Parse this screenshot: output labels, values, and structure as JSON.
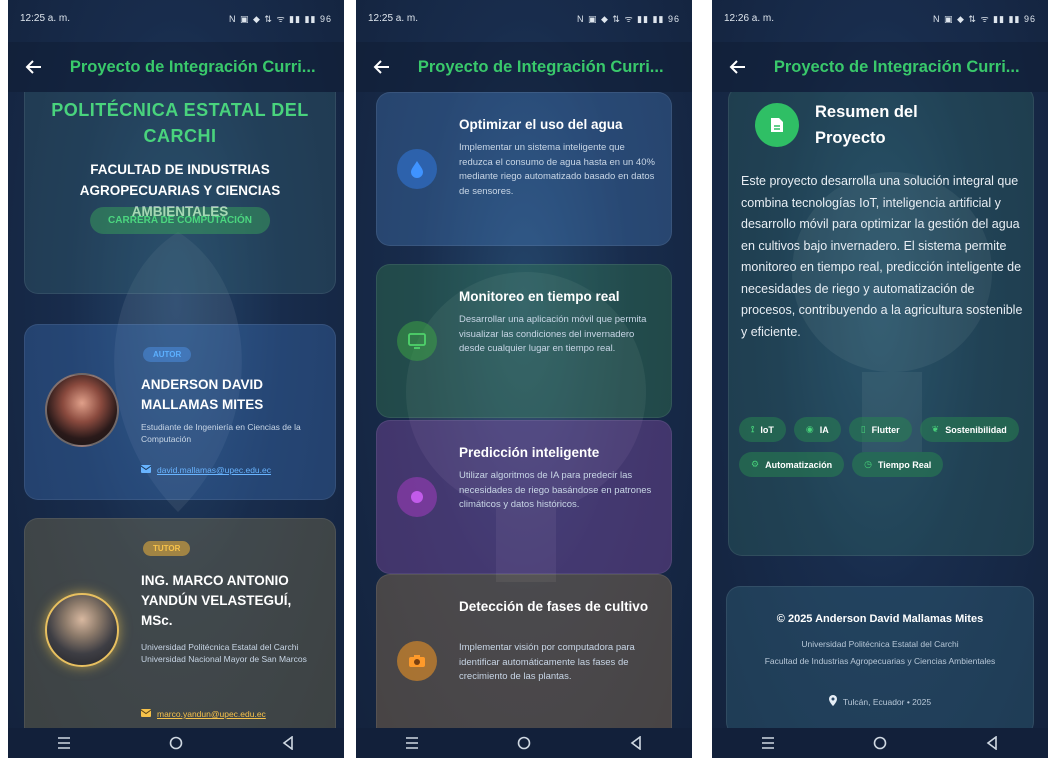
{
  "accent_green": "#39c96b",
  "phones": [
    {
      "status_time": "12:25 a. m.",
      "status_icons": "N ▣ ◆ ⇅ ᯤ ▮▮ ▮▮ 96",
      "title": "Proyecto de Integración Curri..."
    },
    {
      "status_time": "12:25 a. m.",
      "status_icons": "N ▣ ◆ ⇅ ᯤ ▮▮ ▮▮ 96",
      "title": "Proyecto de Integración Curri..."
    },
    {
      "status_time": "12:26 a. m.",
      "status_icons": "N ▣ ◆ ⇅ ᯤ ▮▮ ▮▮ 96",
      "title": "Proyecto de Integración Curri..."
    }
  ],
  "screen1": {
    "university": "POLITÉCNICA ESTATAL DEL CARCHI",
    "faculty": "FACULTAD DE INDUSTRIAS AGROPECUARIAS Y CIENCIAS AMBIENTALES",
    "career": "CARRERA DE COMPUTACIÓN",
    "author": {
      "role": "AUTOR",
      "name": "ANDERSON DAVID MALLAMAS MITES",
      "desc": "Estudiante de Ingeniería en Ciencias de la Computación",
      "email": "david.mallamas@upec.edu.ec"
    },
    "tutor": {
      "role": "TUTOR",
      "name": "ING. MARCO ANTONIO YANDÚN VELASTEGUÍ, MSc.",
      "desc": "Universidad Politécnica Estatal del Carchi Universidad Nacional Mayor de San Marcos",
      "email": "marco.yandun@upec.edu.ec"
    }
  },
  "screen2": {
    "objectives": [
      {
        "icon": "water-drop-icon",
        "title": "Optimizar el uso del agua",
        "text": "Implementar un sistema inteligente que reduzca el consumo de agua hasta en un 40% mediante riego automatizado basado en datos de sensores."
      },
      {
        "icon": "monitor-icon",
        "title": "Monitoreo en tiempo real",
        "text": "Desarrollar una aplicación móvil que permita visualizar las condiciones del invernadero desde cualquier lugar en tiempo real."
      },
      {
        "icon": "brain-icon",
        "title": "Predicción inteligente",
        "text": "Utilizar algoritmos de IA para predecir las necesidades de riego basándose en patrones climáticos y datos históricos."
      },
      {
        "icon": "camera-icon",
        "title": "Detección de fases de cultivo",
        "text": "Implementar visión por computadora para identificar automáticamente las fases de crecimiento de las plantas."
      }
    ]
  },
  "screen3": {
    "summary_title": "Resumen del Proyecto",
    "summary_text": "Este proyecto desarrolla una solución integral que combina tecnologías IoT, inteligencia artificial y desarrollo móvil para optimizar la gestión del agua en cultivos bajo invernadero. El sistema permite monitoreo en tiempo real, predicción inteligente de necesidades de riego y automatización de procesos, contribuyendo a la agricultura sostenible y eficiente.",
    "tags": [
      {
        "icon": "sensor-icon",
        "glyph": "⟟",
        "label": "IoT"
      },
      {
        "icon": "lightbulb-icon",
        "glyph": "◉",
        "label": "IA"
      },
      {
        "icon": "phone-icon",
        "glyph": "▯",
        "label": "Flutter"
      },
      {
        "icon": "leaf-icon",
        "glyph": "❦",
        "label": "Sostenibilidad"
      },
      {
        "icon": "automation-icon",
        "glyph": "⚙",
        "label": "Automatización"
      },
      {
        "icon": "clock-icon",
        "glyph": "◷",
        "label": "Tiempo Real"
      }
    ],
    "copyright": "© 2025 Anderson David Mallamas Mites",
    "footer_uni": "Universidad Politécnica Estatal del Carchi",
    "footer_fac": "Facultad de Industrias Agropecuarias y Ciencias Ambientales",
    "footer_loc": "Tulcán, Ecuador • 2025"
  }
}
